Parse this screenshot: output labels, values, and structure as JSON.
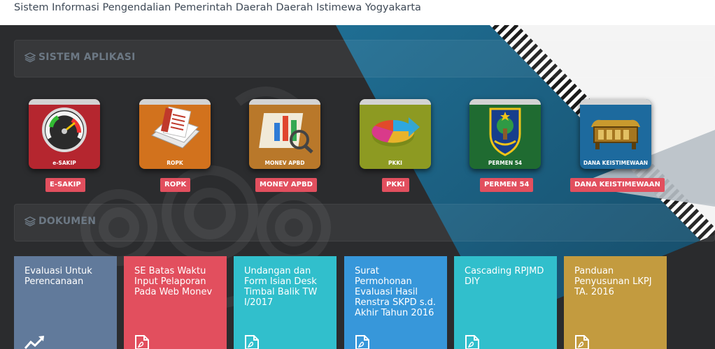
{
  "header": {
    "title": "Sistem Informasi Pengendalian Pemerintah Daerah Daerah Istimewa Yogyakarta"
  },
  "sections": {
    "apps": {
      "title": "SISTEM APLIKASI",
      "icon": "layers-icon"
    },
    "docs": {
      "title": "DOKUMEN",
      "icon": "layers-icon"
    }
  },
  "apps": [
    {
      "caption": "e-SAKIP",
      "label": "E-SAKIP",
      "icon": "gauge-icon",
      "color": "#b5262f"
    },
    {
      "caption": "ROPK",
      "label": "ROPK",
      "icon": "document-stack-icon",
      "color": "#d2721d"
    },
    {
      "caption": "MONEV APBD",
      "label": "MONEV APBD",
      "icon": "chart-magnifier-icon",
      "color": "#b9782a"
    },
    {
      "caption": "PKKI",
      "label": "PKKI",
      "icon": "pie-chart-icon",
      "color": "#8d9a22"
    },
    {
      "caption": "PERMEN 54",
      "label": "PERMEN 54",
      "icon": "emblem-icon",
      "color": "#1f6b31"
    },
    {
      "caption": "DANA KEISTIMEWAAN",
      "label": "DANA KEISTIMEWAAN",
      "icon": "gamelan-icon",
      "color": "#1d6a9e"
    }
  ],
  "documents": [
    {
      "title": "Evaluasi Untuk Perencanaan",
      "icon": "line-chart-icon",
      "color": "#617a9b"
    },
    {
      "title": "SE Batas Waktu Input Pelaporan Pada Web Monev",
      "icon": "pdf-icon",
      "color": "#e24f5e"
    },
    {
      "title": "Undangan dan Form Isian Desk Timbal Balik TW I/2017",
      "icon": "pdf-icon",
      "color": "#31bfcc"
    },
    {
      "title": "Surat Permohonan Evaluasi Hasil Renstra SKPD s.d. Akhir Tahun 2016",
      "icon": "pdf-icon",
      "color": "#3797da"
    },
    {
      "title": "Cascading RPJMD DIY",
      "icon": "pdf-icon",
      "color": "#31bfcc"
    },
    {
      "title": "Panduan Penyusunan LKPJ TA. 2016",
      "icon": "pdf-icon",
      "color": "#c39b3f"
    }
  ],
  "colors": {
    "badge": "#e24f5e",
    "stage_dark": "#2a2b2d",
    "stage_blue": "#1c5a7a",
    "heading_text": "#6c7884"
  }
}
